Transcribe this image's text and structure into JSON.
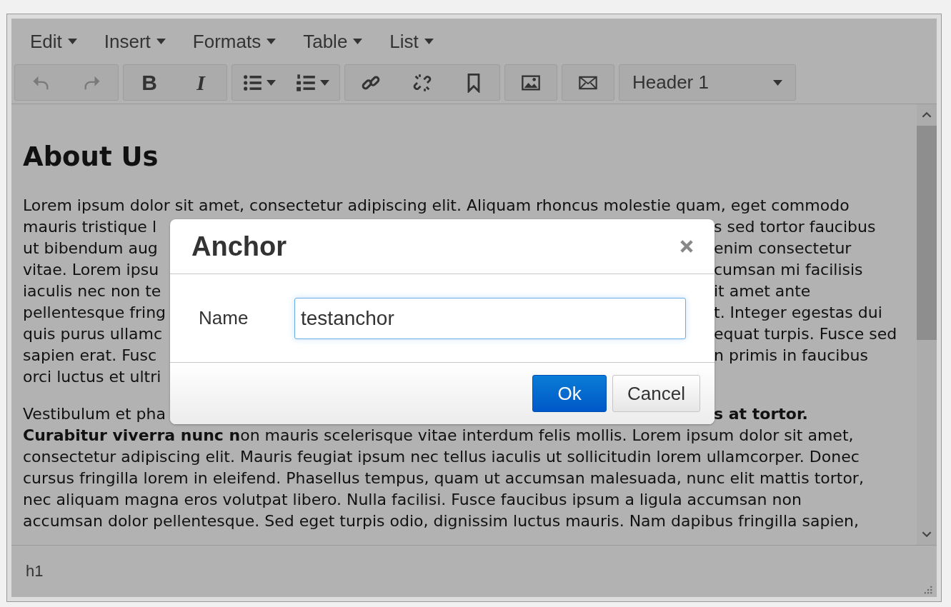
{
  "menubar": [
    {
      "label": "Edit"
    },
    {
      "label": "Insert"
    },
    {
      "label": "Formats"
    },
    {
      "label": "Table"
    },
    {
      "label": "List"
    }
  ],
  "toolbar": [
    {
      "items": [
        {
          "kind": "undo",
          "disabled": true
        },
        {
          "kind": "redo",
          "disabled": true
        }
      ]
    },
    {
      "items": [
        {
          "kind": "bold",
          "label": "B",
          "disabled": false
        },
        {
          "kind": "italic",
          "label": "I",
          "disabled": false
        }
      ]
    },
    {
      "items": [
        {
          "kind": "bullet-list",
          "disabled": false
        },
        {
          "kind": "numbered-list",
          "disabled": false
        }
      ]
    },
    {
      "items": [
        {
          "kind": "link",
          "disabled": false
        },
        {
          "kind": "unlink",
          "disabled": false
        },
        {
          "kind": "bookmark",
          "disabled": false
        }
      ]
    },
    {
      "items": [
        {
          "kind": "image",
          "disabled": false
        }
      ]
    },
    {
      "items": [
        {
          "kind": "mail",
          "disabled": false
        }
      ]
    }
  ],
  "format_select": {
    "value": "Header 1"
  },
  "content": {
    "heading": "About Us",
    "paragraphs": [
      {
        "lines": [
          {
            "kind": "full",
            "text": "Lorem ipsum dolor sit amet, consectetur adipiscing elit. Aliquam rhoncus molestie quam, eget commodo"
          },
          {
            "kind": "split",
            "left": "mauris tristique l",
            "right": "s sed tortor faucibus"
          },
          {
            "kind": "split",
            "left": "ut bibendum aug",
            "right": "enim consectetur"
          },
          {
            "kind": "split",
            "left": "vitae. Lorem ipsu",
            "right": "cumsan mi facilisis"
          },
          {
            "kind": "split",
            "left": "iaculis nec non te",
            "right": "it amet ante"
          },
          {
            "kind": "split",
            "left": "pellentesque fring",
            "right": "t. Integer egestas dui"
          },
          {
            "kind": "split",
            "left": "quis purus ullamc",
            "right": "equat turpis. Fusce sed"
          },
          {
            "kind": "split",
            "left": "sapien erat. Fusc",
            "right": "n primis in faucibus"
          },
          {
            "kind": "split",
            "left": "orci luctus et ultri"
          }
        ]
      },
      {
        "lines": [
          {
            "kind": "split",
            "left": "Vestibulum et pha",
            "right": "**s at tortor.**"
          },
          {
            "kind": "full",
            "text": "**Curabitur viverra nunc n**on mauris scelerisque vitae interdum felis mollis. Lorem ipsum dolor sit amet,"
          },
          {
            "kind": "full",
            "text": "consectetur adipiscing elit. Mauris feugiat ipsum nec tellus iaculis ut sollicitudin lorem ullamcorper. Donec"
          },
          {
            "kind": "full",
            "text": "cursus fringilla lorem in eleifend. Phasellus tempus, quam ut accumsan malesuada, nunc elit mattis tortor,"
          },
          {
            "kind": "full",
            "text": "nec aliquam magna eros volutpat libero. Nulla facilisi. Fusce faucibus ipsum a ligula accumsan non"
          },
          {
            "kind": "full",
            "text": "accumsan dolor pellentesque. Sed eget turpis odio, dignissim luctus mauris. Nam dapibus fringilla sapien,"
          }
        ]
      }
    ]
  },
  "status_bar": {
    "path": "h1"
  },
  "dialog": {
    "title": "Anchor",
    "field": {
      "label": "Name",
      "value": "testanchor"
    },
    "buttons": [
      {
        "label": "Ok",
        "primary": true
      },
      {
        "label": "Cancel",
        "primary": false
      }
    ]
  }
}
